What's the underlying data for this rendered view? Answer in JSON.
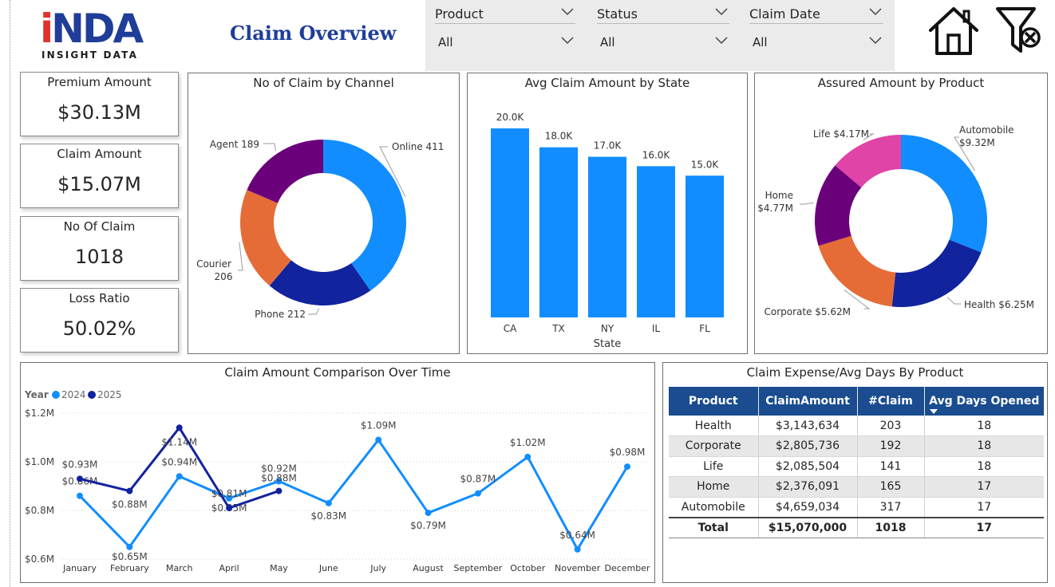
{
  "header": {
    "logo_main": "NDA",
    "logo_i": "i",
    "logo_sub": "INSIGHT DATA",
    "title": "Claim Overview"
  },
  "filters": [
    {
      "label": "Product",
      "value": "All"
    },
    {
      "label": "Status",
      "value": "All"
    },
    {
      "label": "Claim Date",
      "value": "All"
    }
  ],
  "toolbar": {
    "home_icon": "home-icon",
    "clear_filter_icon": "filter-clear-icon"
  },
  "kpis": [
    {
      "label": "Premium Amount",
      "value": "$30.13M"
    },
    {
      "label": "Claim Amount",
      "value": "$15.07M"
    },
    {
      "label": "No Of Claim",
      "value": "1018"
    },
    {
      "label": "Loss Ratio",
      "value": "50.02%"
    }
  ],
  "colors": {
    "blue": "#118dff",
    "navy": "#12239e",
    "orange": "#e66c37",
    "purple": "#6b007b",
    "pink": "#e044a7",
    "header_blue": "#1a4c8f"
  },
  "chart_data": [
    {
      "id": "channel",
      "type": "pie",
      "donut": true,
      "title": "No of Claim by Channel",
      "slices": [
        {
          "label": "Online",
          "value": 411,
          "text": "Online 411",
          "color": "#118dff"
        },
        {
          "label": "Phone",
          "value": 212,
          "text": "Phone 212",
          "color": "#12239e"
        },
        {
          "label": "Courier",
          "value": 206,
          "text": "Courier",
          "text2": "206",
          "color": "#e66c37"
        },
        {
          "label": "Agent",
          "value": 189,
          "text": "Agent 189",
          "color": "#6b007b"
        }
      ]
    },
    {
      "id": "state",
      "type": "bar",
      "title": "Avg Claim Amount by State",
      "xlabel": "State",
      "ylabel": "",
      "ylim": [
        0,
        20000
      ],
      "categories": [
        "CA",
        "TX",
        "NY",
        "IL",
        "FL"
      ],
      "values": [
        20000,
        18000,
        17000,
        16000,
        15000
      ],
      "labels": [
        "20.0K",
        "18.0K",
        "17.0K",
        "16.0K",
        "15.0K"
      ],
      "color": "#118dff"
    },
    {
      "id": "product",
      "type": "pie",
      "donut": true,
      "title": "Assured Amount by Product",
      "slices": [
        {
          "label": "Automobile",
          "value": 9.32,
          "text": "Automobile",
          "text2": "$9.32M",
          "color": "#118dff"
        },
        {
          "label": "Health",
          "value": 6.25,
          "text": "Health $6.25M",
          "color": "#12239e"
        },
        {
          "label": "Corporate",
          "value": 5.62,
          "text": "Corporate $5.62M",
          "color": "#e66c37"
        },
        {
          "label": "Home",
          "value": 4.77,
          "text": "Home",
          "text2": "$4.77M",
          "color": "#6b007b"
        },
        {
          "label": "Life",
          "value": 4.17,
          "text": "Life $4.17M",
          "color": "#e044a7"
        }
      ]
    },
    {
      "id": "timeline",
      "type": "line",
      "title": "Claim Amount Comparison Over Time",
      "legend_title": "Year",
      "ylim": [
        0.6,
        1.2
      ],
      "y_ticks": [
        "$0.6M",
        "$0.8M",
        "$1.0M",
        "$1.2M"
      ],
      "y_tick_values": [
        0.6,
        0.8,
        1.0,
        1.2
      ],
      "grid": true,
      "categories": [
        "January",
        "February",
        "March",
        "April",
        "May",
        "June",
        "July",
        "August",
        "September",
        "October",
        "November",
        "December"
      ],
      "series": [
        {
          "name": "2024",
          "color": "#118dff",
          "values": [
            0.86,
            0.65,
            0.94,
            0.85,
            0.92,
            0.83,
            1.09,
            0.79,
            0.87,
            1.02,
            0.64,
            0.98
          ],
          "labels": [
            "$0.86M",
            "$0.65M",
            "$0.94M",
            "$0.85M",
            "$0.92M",
            "$0.83M",
            "$1.09M",
            "$0.79M",
            "$0.87M",
            "$1.02M",
            "$0.64M",
            "$0.98M"
          ]
        },
        {
          "name": "2025",
          "color": "#12239e",
          "values": [
            0.93,
            0.88,
            1.14,
            0.81,
            0.88
          ],
          "labels": [
            "$0.93M",
            "$0.88M",
            "$1.14M",
            "$0.81M",
            "$0.88M"
          ]
        }
      ]
    },
    {
      "id": "expense",
      "type": "table",
      "title": "Claim Expense/Avg Days By Product",
      "columns": [
        "Product",
        "ClaimAmount",
        "#Claim",
        "Avg Days Opened"
      ],
      "rows": [
        [
          "Health",
          "$3,143,634",
          "203",
          "18"
        ],
        [
          "Corporate",
          "$2,805,736",
          "192",
          "18"
        ],
        [
          "Life",
          "$2,085,504",
          "141",
          "18"
        ],
        [
          "Home",
          "$2,376,091",
          "165",
          "17"
        ],
        [
          "Automobile",
          "$4,659,034",
          "317",
          "17"
        ]
      ],
      "total": [
        "Total",
        "$15,070,000",
        "1018",
        "17"
      ]
    }
  ]
}
